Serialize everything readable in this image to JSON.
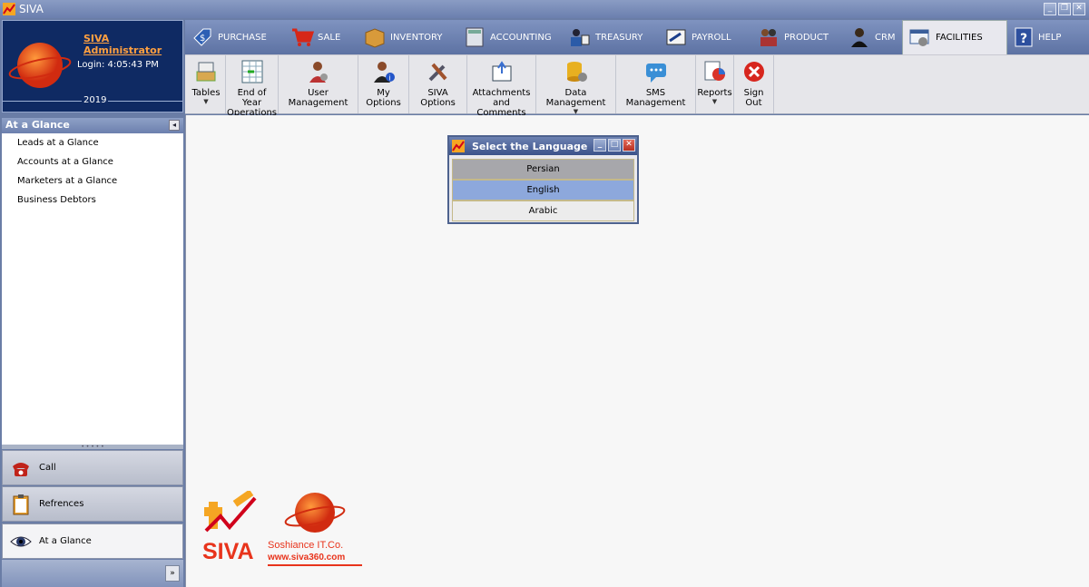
{
  "window": {
    "title": "SIVA"
  },
  "profile": {
    "admin_name": "SIVA Administrator",
    "login_text": "Login: 4:05:43 PM",
    "year": "2019"
  },
  "tabs": [
    {
      "label": "PURCHASE",
      "icon": "tag-icon"
    },
    {
      "label": "SALE",
      "icon": "cart-icon"
    },
    {
      "label": "INVENTORY",
      "icon": "box-icon"
    },
    {
      "label": "ACCOUNTING",
      "icon": "calculator-icon"
    },
    {
      "label": "TREASURY",
      "icon": "users-icon"
    },
    {
      "label": "PAYROLL",
      "icon": "paycheck-icon"
    },
    {
      "label": "PRODUCT",
      "icon": "people-icon"
    },
    {
      "label": "CRM",
      "icon": "user-icon"
    },
    {
      "label": "FACILITIES",
      "icon": "gear-window-icon",
      "active": true
    },
    {
      "label": "HELP",
      "icon": "help-icon"
    }
  ],
  "ribbon": [
    {
      "label": "Tables",
      "icon": "tables-icon",
      "dropdown": true
    },
    {
      "label": "End of Year Operations",
      "icon": "spreadsheet-icon"
    },
    {
      "label": "User Management",
      "icon": "user-gear-icon"
    },
    {
      "label": "My Options",
      "icon": "user-info-icon"
    },
    {
      "label": "SIVA Options",
      "icon": "tools-icon"
    },
    {
      "label": "Attachments and Comments",
      "icon": "attachment-icon"
    },
    {
      "label": "Data Management",
      "icon": "database-icon",
      "dropdown": true
    },
    {
      "label": "SMS Management",
      "icon": "sms-icon"
    },
    {
      "label": "Reports",
      "icon": "reports-icon",
      "dropdown": true
    },
    {
      "label": "Sign Out",
      "icon": "signout-icon"
    }
  ],
  "glance": {
    "header": "At a Glance",
    "items": [
      "Leads at a Glance",
      "Accounts at a Glance",
      "Marketers at a Glance",
      "Business Debtors"
    ]
  },
  "nav_buttons": [
    {
      "label": "Call",
      "icon": "phone-icon"
    },
    {
      "label": "Refrences",
      "icon": "clipboard-icon"
    },
    {
      "label": "At a Glance",
      "icon": "eye-icon"
    }
  ],
  "dialog": {
    "title": "Select the Language",
    "options": [
      "Persian",
      "English",
      "Arabic"
    ],
    "selected": "English"
  },
  "footer_logo": {
    "brand": "SIVA",
    "company": "Soshiance IT.Co.",
    "url": "www.siva360.com"
  },
  "colors": {
    "accent": "#0f2a63",
    "brand_red": "#e8341c",
    "admin_orange": "#ffa040"
  }
}
